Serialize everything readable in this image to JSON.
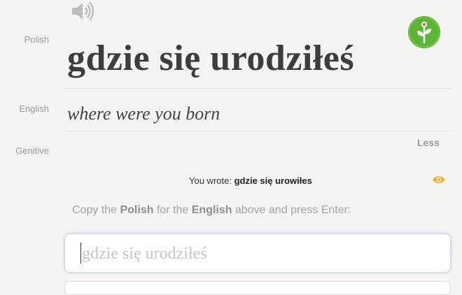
{
  "labels": {
    "polish": "Polish",
    "english": "English",
    "genitive": "Genitive"
  },
  "icons": {
    "speaker": "speaker-icon",
    "logo": "memrise-flower-logo",
    "eye": "eye-icon"
  },
  "colors": {
    "logo_green": "#5cb434",
    "eye_orange": "#f0a81e",
    "input_focus": "#cdd9e6"
  },
  "card": {
    "polish_text": "gdzie się urodziłeś",
    "english_text": "where were you born",
    "less_label": "Less"
  },
  "feedback": {
    "you_wrote_label": "You wrote:",
    "you_wrote_value": "gdzie się urowiłes"
  },
  "instruction": {
    "part1": "Copy the ",
    "bold1": "Polish",
    "part2": " for the ",
    "bold2": "English",
    "part3": " above and press Enter:"
  },
  "answer": {
    "placeholder": "gdzie się urodziłeś",
    "value": ""
  }
}
